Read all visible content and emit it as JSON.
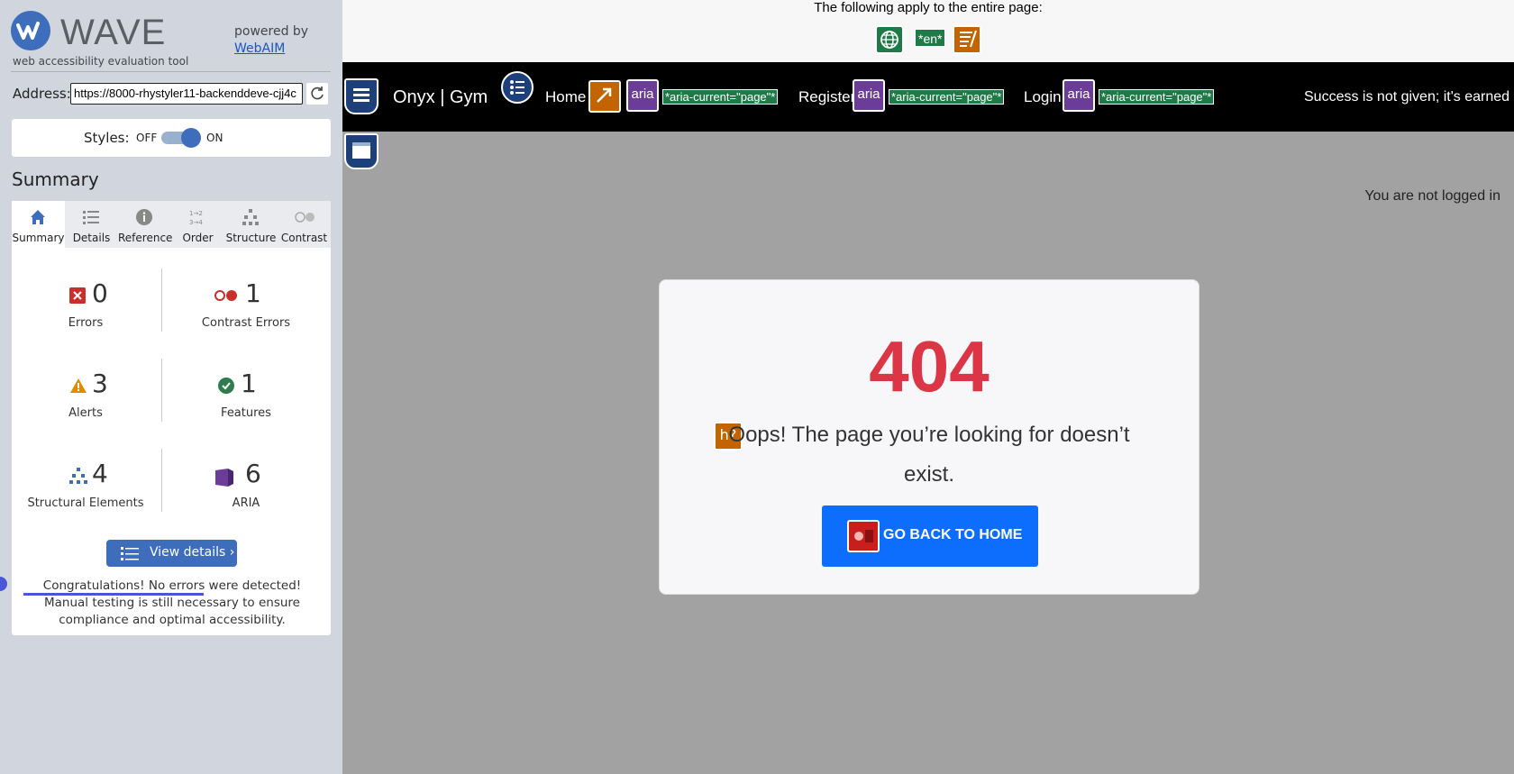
{
  "wave": {
    "logo_text": "WAVE",
    "tagline": "web accessibility evaluation tool",
    "powered_by": "powered by",
    "webaim_link": "WebAIM",
    "address_label": "Address:",
    "address_value": "https://8000-rhystyler11-backenddeve-cjj4c",
    "styles_label": "Styles:",
    "styles_off": "OFF",
    "styles_on": "ON",
    "summary_heading": "Summary",
    "tabs": [
      {
        "label": "Summary",
        "icon": "home-icon"
      },
      {
        "label": "Details",
        "icon": "list-icon"
      },
      {
        "label": "Reference",
        "icon": "info-icon"
      },
      {
        "label": "Order",
        "icon": "order-icon"
      },
      {
        "label": "Structure",
        "icon": "structure-icon"
      },
      {
        "label": "Contrast",
        "icon": "contrast-icon"
      }
    ],
    "stats": {
      "errors": {
        "value": "0",
        "label": "Errors"
      },
      "contrast_errors": {
        "value": "1",
        "label": "Contrast Errors"
      },
      "alerts": {
        "value": "3",
        "label": "Alerts"
      },
      "features": {
        "value": "1",
        "label": "Features"
      },
      "structural": {
        "value": "4",
        "label": "Structural Elements"
      },
      "aria": {
        "value": "6",
        "label": "ARIA"
      }
    },
    "view_details": "View details ›",
    "congrats": "Congratulations! No errors were detected! Manual testing is still necessary to ensure compliance and optimal accessibility."
  },
  "page": {
    "entire_page_note": "The following apply to the entire page:",
    "lang_badge": "*en*",
    "brand": "Onyx | Gym",
    "nav": {
      "home": "Home",
      "register": "Register",
      "login": "Login",
      "aria_label": "aria",
      "aria_current": "*aria-current=\"page\"*"
    },
    "tagline": "Success is not given; it's earned",
    "logged_out": "You are not logged in",
    "error_code": "404",
    "error_message": "Oops! The page you’re looking for doesn’t exist.",
    "back_button": "GO BACK TO HOME"
  },
  "colors": {
    "wave_blue": "#3d6dbb",
    "error_red": "#dc3545",
    "button_blue": "#0d6efd",
    "aria_purple": "#6b3d99",
    "feature_green": "#1f7a47",
    "alert_orange": "#c46400"
  }
}
